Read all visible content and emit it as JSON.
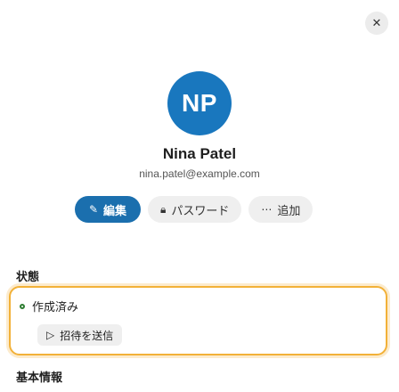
{
  "dialog": {
    "close_icon": "close-icon"
  },
  "profile": {
    "initials": "NP",
    "avatar_color": "#1977be",
    "name": "Nina Patel",
    "email": "nina.patel@example.com"
  },
  "actions": {
    "edit": {
      "icon": "pencil-icon",
      "label": "編集"
    },
    "password": {
      "icon": "lock-icon",
      "label": "パスワード"
    },
    "more": {
      "icon": "more-icon",
      "label": "追加"
    }
  },
  "status_section": {
    "title": "状態",
    "current": "作成済み",
    "current_dot_color": "#2e7d32",
    "action_label": "招待を送信",
    "action_icon": "send-icon",
    "highlight_color": "#f2b138"
  },
  "basic_info_section": {
    "title": "基本情報"
  }
}
